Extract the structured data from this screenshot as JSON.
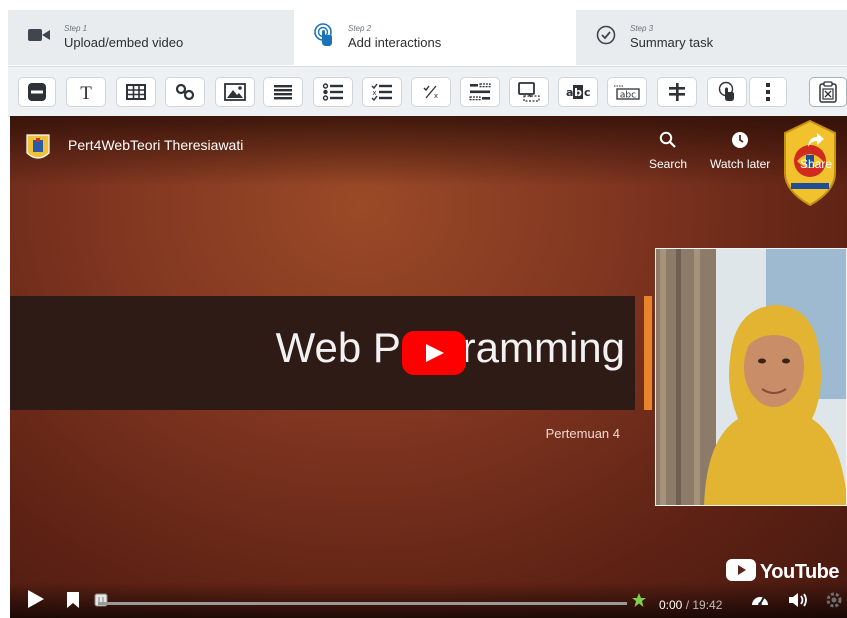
{
  "steps": [
    {
      "number": "Step 1",
      "title": "Upload/embed video",
      "icon": "video-camera-icon"
    },
    {
      "number": "Step 2",
      "title": "Add interactions",
      "icon": "touch-icon"
    },
    {
      "number": "Step 3",
      "title": "Summary task",
      "icon": "check-circle-icon"
    }
  ],
  "toolbar": {
    "tools": [
      "label-tool",
      "text-tool",
      "table-tool",
      "link-tool",
      "image-tool",
      "statements-tool",
      "single-choice-tool",
      "multiple-choice-tool",
      "true-false-tool",
      "fill-blanks-tool",
      "drag-drop-tool",
      "mark-words-tool",
      "drag-text-tool",
      "crossroads-tool",
      "navigation-hotspot-tool",
      "more-tool",
      "paste-tool"
    ]
  },
  "video": {
    "channel_title": "Pert4WebTeori Theresiawati",
    "search_label": "Search",
    "watch_later_label": "Watch later",
    "share_label": "Share",
    "slide_title": "Web Programming",
    "slide_subtitle": "Pertemuan 4",
    "youtube_logo_text": "YouTube",
    "current_time": "0:00",
    "total_time": "/ 19:42",
    "progress": 0
  },
  "colors": {
    "accent_play": "#ff0000",
    "toolbar_bg": "#eef1f4",
    "banner_accent": "#e8842c",
    "step_active": "#ffffff",
    "step_inactive": "#e9ecef"
  }
}
